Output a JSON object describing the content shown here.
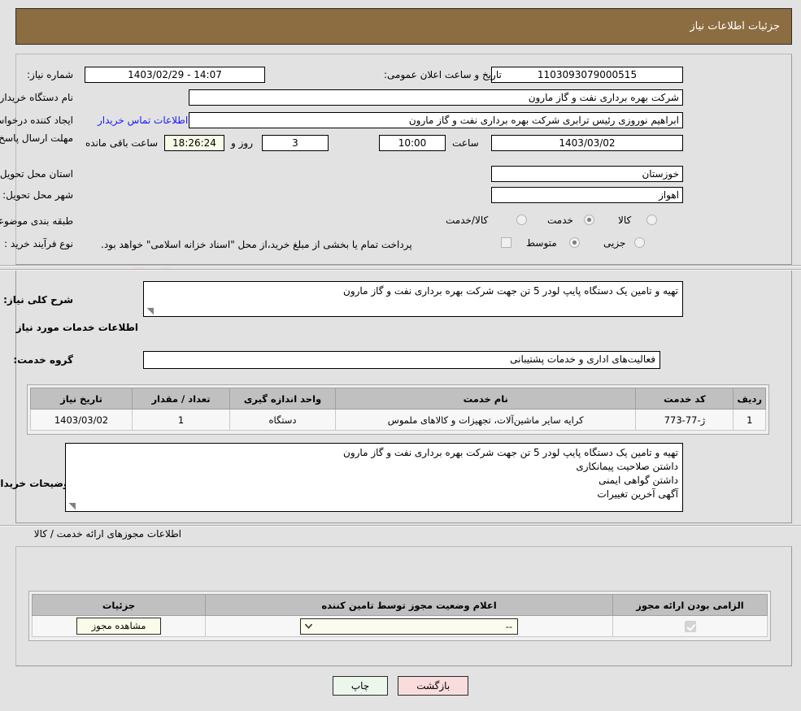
{
  "header": {
    "title": "جزئیات اطلاعات نیاز"
  },
  "form": {
    "need_number_label": "شماره نیاز:",
    "need_number_value": "1103093079000515",
    "announce_label": "تاریخ و ساعت اعلان عمومی:",
    "announce_value": "14:07 - 1403/02/29",
    "buyer_org_label": "نام دستگاه خریدار:",
    "buyer_org_value": "شرکت بهره برداری نفت و گاز مارون",
    "creator_label": "ایجاد کننده درخواست:",
    "creator_value": "ابراهیم نوروزی رئیس ترابری شرکت بهره برداری نفت و گاز مارون",
    "contact_link": "اطلاعات تماس خریدار",
    "deadline_label": "مهلت ارسال پاسخ: تا تاریخ:",
    "deadline_date": "1403/03/02",
    "hour_label": "ساعت",
    "deadline_time": "10:00",
    "days_value": "3",
    "days_label": "روز و",
    "countdown_value": "18:26:24",
    "remaining_label": "ساعت باقی مانده",
    "province_label": "استان محل تحویل:",
    "province_value": "خوزستان",
    "city_label": "شهر محل تحویل:",
    "city_value": "اهواز",
    "category_label": "طبقه بندی موضوعی:",
    "category_options": [
      "کالا",
      "خدمت",
      "کالا/خدمت"
    ],
    "category_selected": "خدمت",
    "process_label": "نوع فرآیند خرید :",
    "process_options": [
      "جزیی",
      "متوسط"
    ],
    "process_selected": "متوسط",
    "payment_note": "پرداخت تمام یا بخشی از مبلغ خرید،از محل \"اسناد خزانه اسلامی\" خواهد بود."
  },
  "description": {
    "label": "شرح کلی نیاز:",
    "value": "تهیه و تامین یک دستگاه پایپ لودر 5 تن جهت شرکت بهره برداری نفت و گاز مارون"
  },
  "services_section": {
    "title": "اطلاعات خدمات مورد نیاز",
    "group_label": "گروه خدمت:",
    "group_value": "فعالیت‌های اداری و خدمات پشتیبانی"
  },
  "items_table": {
    "columns": [
      "ردیف",
      "کد خدمت",
      "نام خدمت",
      "واحد اندازه گیری",
      "تعداد / مقدار",
      "تاریخ نیاز"
    ],
    "rows": [
      {
        "row": "1",
        "code": "ژ-77-773",
        "name": "کرایه سایر ماشین‌آلات، تجهیزات و کالاهای ملموس",
        "unit": "دستگاه",
        "qty": "1",
        "date": "1403/03/02"
      }
    ]
  },
  "buyer_notes": {
    "label": "توضیحات خریدار:",
    "lines": [
      "تهیه و تامین یک دستگاه پایپ لودر 5 تن جهت شرکت بهره برداری نفت و گاز مارون",
      "داشتن صلاحیت پیمانکاری",
      "داشتن گواهی ایمنی",
      "آگهی آخرین تغییرات"
    ]
  },
  "licenses_section": {
    "title": "اطلاعات مجوزهای ارائه خدمت / کالا",
    "columns": [
      "الزامی بودن ارائه مجوز",
      "اعلام وضعیت مجوز توسط تامین کننده",
      "جزئیات"
    ],
    "row": {
      "required_checked": true,
      "status_value": "--",
      "details_button": "مشاهده مجوز"
    }
  },
  "footer": {
    "print_label": "چاپ",
    "back_label": "بازگشت"
  },
  "watermark": {
    "text": "AriaTender.net"
  },
  "colors": {
    "header_bar": "#8C6D41",
    "page_bg": "#e2e2e2",
    "link": "#1a1aff",
    "print_btn": "#ecf7ec",
    "back_btn": "#fadcdc",
    "yellow_field": "#fbfbe9"
  }
}
